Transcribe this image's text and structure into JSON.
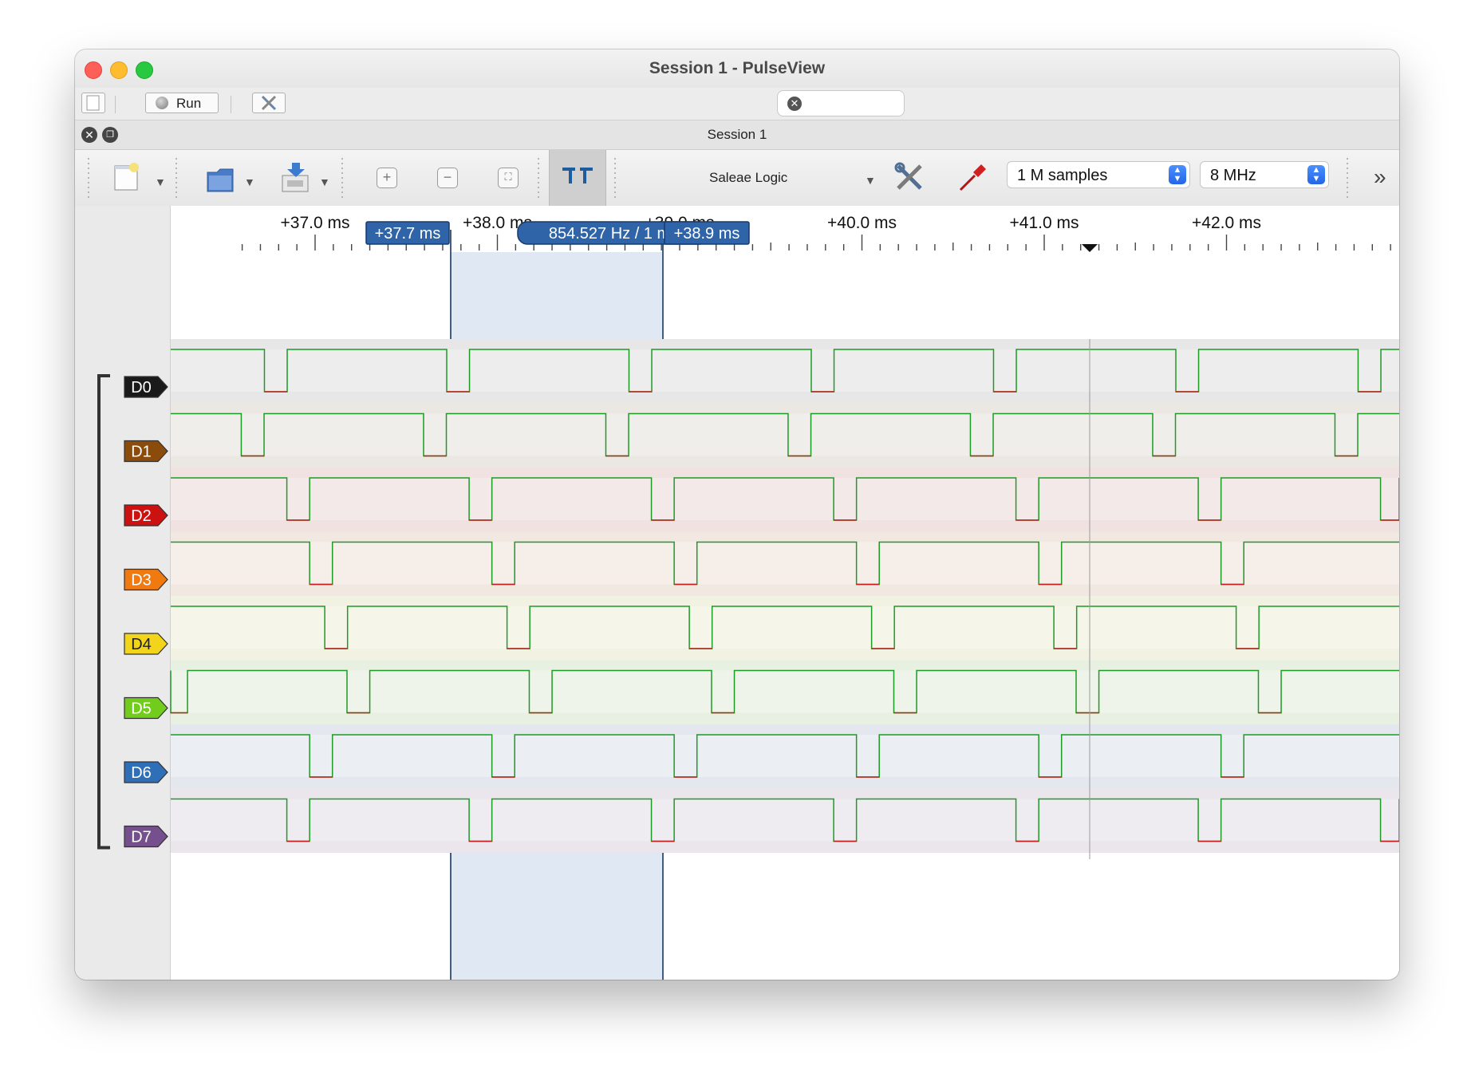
{
  "window": {
    "title": "Session 1 - PulseView"
  },
  "toolbar1": {
    "run_label": "Run"
  },
  "session": {
    "title": "Session 1"
  },
  "toolbar2": {
    "device": "Saleae Logic",
    "samples": "1 M samples",
    "rate": "8 MHz"
  },
  "ruler": {
    "ticks": [
      "+37.0 ms",
      "+38.0 ms",
      "+39.0 ms",
      "+40.0 ms",
      "+41.0 ms",
      "+42.0 ms"
    ],
    "cursor_left": "+37.7 ms",
    "cursor_right": "+38.9 ms",
    "cursor_span": "854.527 Hz / 1 ms"
  },
  "channels": [
    {
      "name": "D0",
      "color": "#1a1a1a"
    },
    {
      "name": "D1",
      "color": "#8a4b0b"
    },
    {
      "name": "D2",
      "color": "#cc1111"
    },
    {
      "name": "D3",
      "color": "#f07a10"
    },
    {
      "name": "D4",
      "color": "#f2d41a"
    },
    {
      "name": "D5",
      "color": "#72cc1c"
    },
    {
      "name": "D6",
      "color": "#2f6fb8"
    },
    {
      "name": "D7",
      "color": "#76508d"
    }
  ]
}
